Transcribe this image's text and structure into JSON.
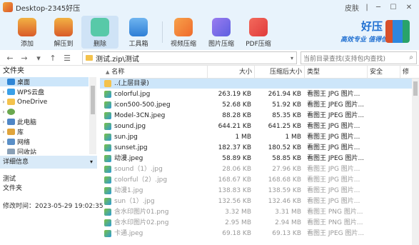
{
  "window": {
    "title": "Desktop-2345好压",
    "skin_label": "皮肤"
  },
  "toolbar": {
    "items": [
      {
        "label": "添加",
        "icon": "add-box-icon"
      },
      {
        "label": "解压到",
        "icon": "extract-box-icon"
      },
      {
        "label": "删除",
        "icon": "recycle-icon"
      },
      {
        "label": "工具箱",
        "icon": "toolbox-icon"
      },
      {
        "label": "视频压缩",
        "icon": "video-compress-icon"
      },
      {
        "label": "图片压缩",
        "icon": "image-compress-icon"
      },
      {
        "label": "PDF压缩",
        "icon": "pdf-compress-icon"
      }
    ],
    "active_index": 2
  },
  "brand": {
    "name": "好压",
    "slogan": "高效专业 值得信赖"
  },
  "address": {
    "path": "测试.zip\\测试",
    "search_placeholder": "当前目录查找(支持包内查找)"
  },
  "sidebar": {
    "header": "文件夹",
    "items": [
      {
        "label": "桌面",
        "selected": true,
        "expandable": false,
        "color": "#2f86d6"
      },
      {
        "label": "WPS云盘",
        "selected": false,
        "expandable": true,
        "color": "#3aa0e8"
      },
      {
        "label": "OneDrive",
        "selected": false,
        "expandable": true,
        "color": "#f4c24c"
      },
      {
        "label": "",
        "selected": false,
        "expandable": true,
        "color": "#6aa84f"
      },
      {
        "label": "此电脑",
        "selected": false,
        "expandable": true,
        "color": "#4f86c6"
      },
      {
        "label": "库",
        "selected": false,
        "expandable": true,
        "color": "#e0a43b"
      },
      {
        "label": "网络",
        "selected": false,
        "expandable": true,
        "color": "#5a8fc7"
      },
      {
        "label": "回收站",
        "selected": false,
        "expandable": false,
        "color": "#8aa0b6"
      }
    ]
  },
  "details": {
    "header": "详细信息",
    "name": "测试",
    "type": "文件夹",
    "modified": "修改时间：2023-05-29 19:02:35"
  },
  "columns": {
    "name": "名称",
    "size": "大小",
    "packed": "压缩后大小",
    "type": "类型",
    "security": "安全",
    "modified": "修"
  },
  "files": [
    {
      "name": "..(上层目录)",
      "size": "",
      "packed": "",
      "type": "",
      "kind": "folder",
      "selected": true,
      "dim": false
    },
    {
      "name": "colorful.jpg",
      "size": "263.19 KB",
      "packed": "261.94 KB",
      "type": "看图王 JPG 图片...",
      "kind": "img",
      "selected": false,
      "dim": false
    },
    {
      "name": "icon500-500.jpeg",
      "size": "52.68 KB",
      "packed": "51.92 KB",
      "type": "看图王 JPEG 图片...",
      "kind": "img",
      "selected": false,
      "dim": false
    },
    {
      "name": "Model-3CN.jpeg",
      "size": "88.28 KB",
      "packed": "85.35 KB",
      "type": "看图王 JPEG 图片...",
      "kind": "img",
      "selected": false,
      "dim": false
    },
    {
      "name": "sound.jpg",
      "size": "644.21 KB",
      "packed": "641.25 KB",
      "type": "看图王 JPG 图片...",
      "kind": "img",
      "selected": false,
      "dim": false
    },
    {
      "name": "sun.jpg",
      "size": "1 MB",
      "packed": "1 MB",
      "type": "看图王 JPG 图片...",
      "kind": "img",
      "selected": false,
      "dim": false
    },
    {
      "name": "sunset.jpg",
      "size": "182.37 KB",
      "packed": "180.52 KB",
      "type": "看图王 JPG 图片...",
      "kind": "img",
      "selected": false,
      "dim": false
    },
    {
      "name": "动漫.jpeg",
      "size": "58.89 KB",
      "packed": "58.85 KB",
      "type": "看图王 JPEG 图片...",
      "kind": "img",
      "selected": false,
      "dim": false
    },
    {
      "name": "sound（1）.jpg",
      "size": "28.06 KB",
      "packed": "27.96 KB",
      "type": "看图王 JPG 图片...",
      "kind": "img",
      "selected": false,
      "dim": true
    },
    {
      "name": "colorful（2）.jpg",
      "size": "168.67 KB",
      "packed": "168.68 KB",
      "type": "看图王 JPG 图片...",
      "kind": "img",
      "selected": false,
      "dim": true
    },
    {
      "name": "动漫1.jpg",
      "size": "138.83 KB",
      "packed": "138.59 KB",
      "type": "看图王 JPG 图片...",
      "kind": "img",
      "selected": false,
      "dim": true
    },
    {
      "name": "sun（1）.jpg",
      "size": "132.56 KB",
      "packed": "132.46 KB",
      "type": "看图王 JPG 图片...",
      "kind": "img",
      "selected": false,
      "dim": true
    },
    {
      "name": "含水印图片01.png",
      "size": "3.32 MB",
      "packed": "3.31 MB",
      "type": "看图王 PNG 图片...",
      "kind": "img",
      "selected": false,
      "dim": true
    },
    {
      "name": "含水印图片02.png",
      "size": "2.95 MB",
      "packed": "2.94 MB",
      "type": "看图王 PNG 图片...",
      "kind": "img",
      "selected": false,
      "dim": true
    },
    {
      "name": "卡通.jpeg",
      "size": "69.18 KB",
      "packed": "69.13 KB",
      "type": "看图王 JPEG 图片...",
      "kind": "img",
      "selected": false,
      "dim": true
    }
  ]
}
